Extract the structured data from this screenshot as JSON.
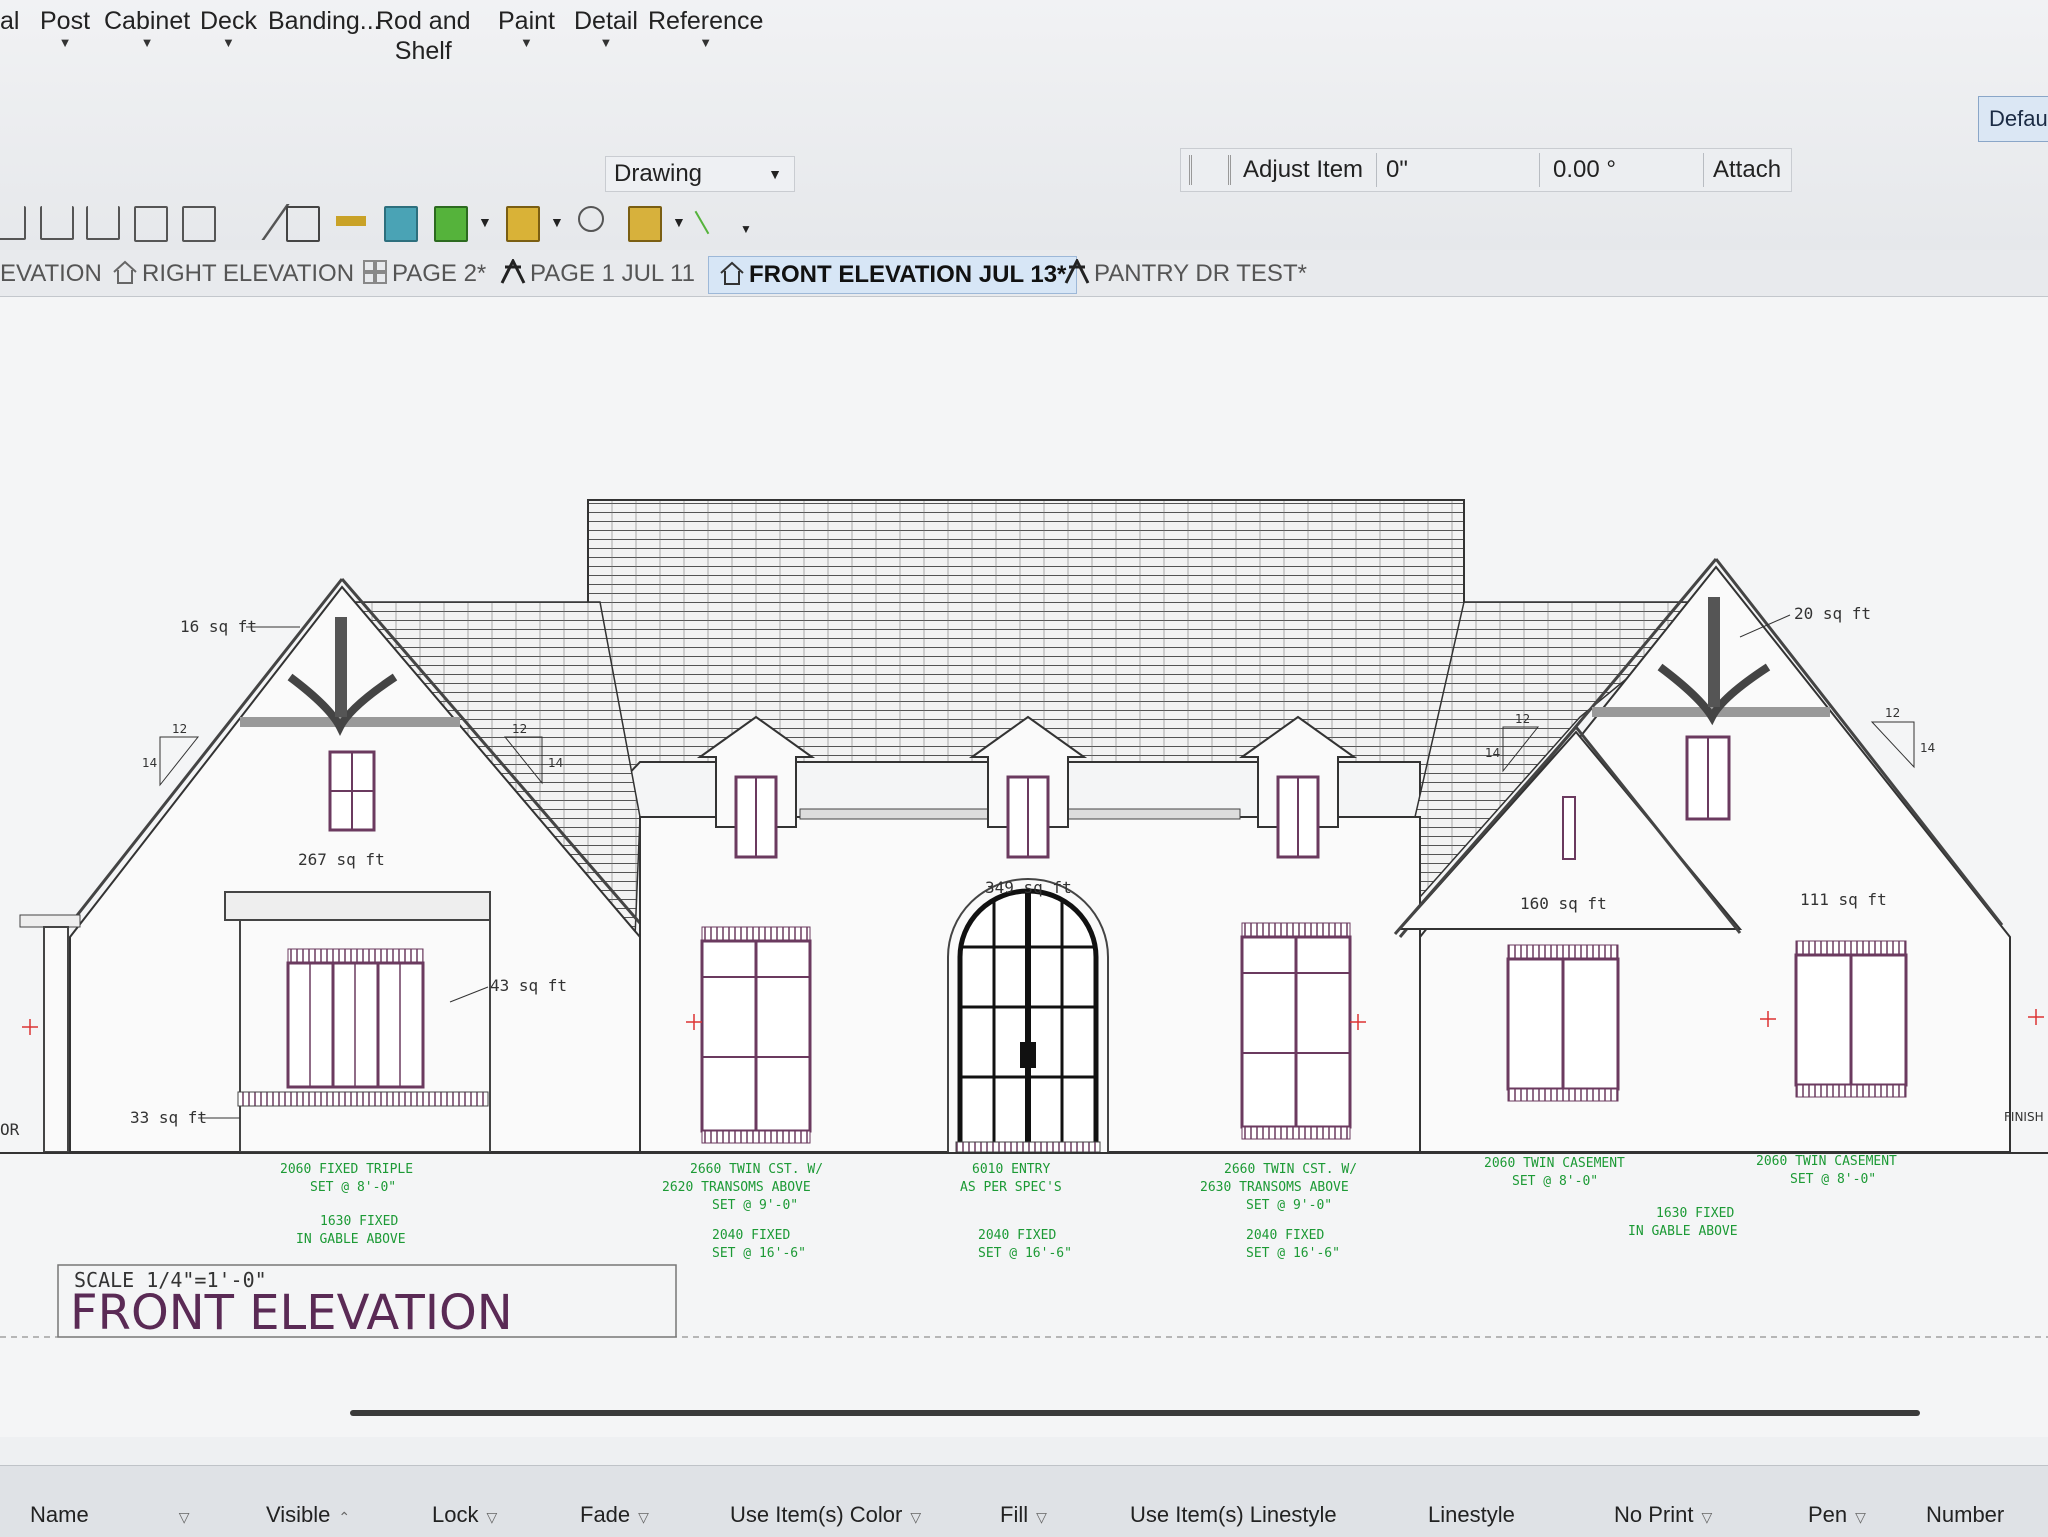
{
  "menu": {
    "items": [
      "al",
      "Post",
      "Cabinet",
      "Deck",
      "Banding...",
      "Rod and\nShelf",
      "Paint",
      "Detail",
      "Reference"
    ]
  },
  "ribbon": {
    "drawing_group": "Drawing",
    "adjust_item": "Adjust Item",
    "offset_value": "0\"",
    "angle_value": "0.00 °",
    "attach": "Attach",
    "default_button": "Defau"
  },
  "tabs": [
    {
      "label": "EVATION",
      "icon": "",
      "active": false
    },
    {
      "label": "RIGHT ELEVATION",
      "icon": "house-icon",
      "active": false
    },
    {
      "label": "PAGE 2*",
      "icon": "layout-page-icon",
      "active": false
    },
    {
      "label": "PAGE 1 JUL 11",
      "icon": "cross-section-icon",
      "active": false
    },
    {
      "label": "FRONT ELEVATION JUL 13*",
      "icon": "house-icon",
      "active": true
    },
    {
      "label": "PANTRY DR TEST*",
      "icon": "cross-section-icon",
      "active": false
    }
  ],
  "drawing": {
    "scale": "SCALE 1/4\"=1'-0\"",
    "title": "FRONT ELEVATION",
    "areas": {
      "left_gable": "16 sq ft",
      "left_wall": "267 sq ft",
      "bay_roof": "43 sq ft",
      "bay_base": "33 sq ft",
      "center": "349 sq ft",
      "right_gable": "20 sq ft",
      "right_inner": "160 sq ft",
      "right_outer": "111 sq ft"
    },
    "pitch": {
      "rise": "12",
      "run": "14"
    },
    "notes": {
      "n1": [
        "2060 FIXED TRIPLE",
        "SET @ 8'-0\""
      ],
      "n1b": [
        "1630 FIXED",
        "IN GABLE ABOVE"
      ],
      "n2": [
        "2660 TWIN CST. W/",
        "2620 TRANSOMS ABOVE",
        "SET @ 9'-0\""
      ],
      "n2b": [
        "2040 FIXED",
        "SET @ 16'-6\""
      ],
      "n3": [
        "6010 ENTRY",
        "AS PER SPEC'S"
      ],
      "n3b": [
        "2040 FIXED",
        "SET @ 16'-6\""
      ],
      "n4": [
        "2660 TWIN CST. W/",
        "2630 TRANSOMS ABOVE",
        "SET @ 9'-0\""
      ],
      "n4b": [
        "2040 FIXED",
        "SET @ 16'-6\""
      ],
      "n5": [
        "2060 TWIN CASEMENT",
        "SET @ 8'-0\""
      ],
      "n6": [
        "2060 TWIN CASEMENT",
        "SET @ 8'-0\""
      ],
      "n6b": [
        "1630 FIXED",
        "IN GABLE ABOVE"
      ]
    },
    "edge_labels": {
      "left": "OR",
      "right": "FINISH"
    }
  },
  "status_columns": [
    {
      "label": "Name"
    },
    {
      "label": "Visible"
    },
    {
      "label": "Lock"
    },
    {
      "label": "Fade"
    },
    {
      "label": "Use Item(s) Color"
    },
    {
      "label": "Fill"
    },
    {
      "label": "Use Item(s) Linestyle"
    },
    {
      "label": "Linestyle"
    },
    {
      "label": "No Print"
    },
    {
      "label": "Pen"
    },
    {
      "label": "Number"
    }
  ],
  "colors": {
    "accent": "#d7e6f6",
    "line": "#3b3b3b",
    "note": "#1c9a35",
    "window": "#6b3a5f",
    "title": "#5a2a55"
  }
}
